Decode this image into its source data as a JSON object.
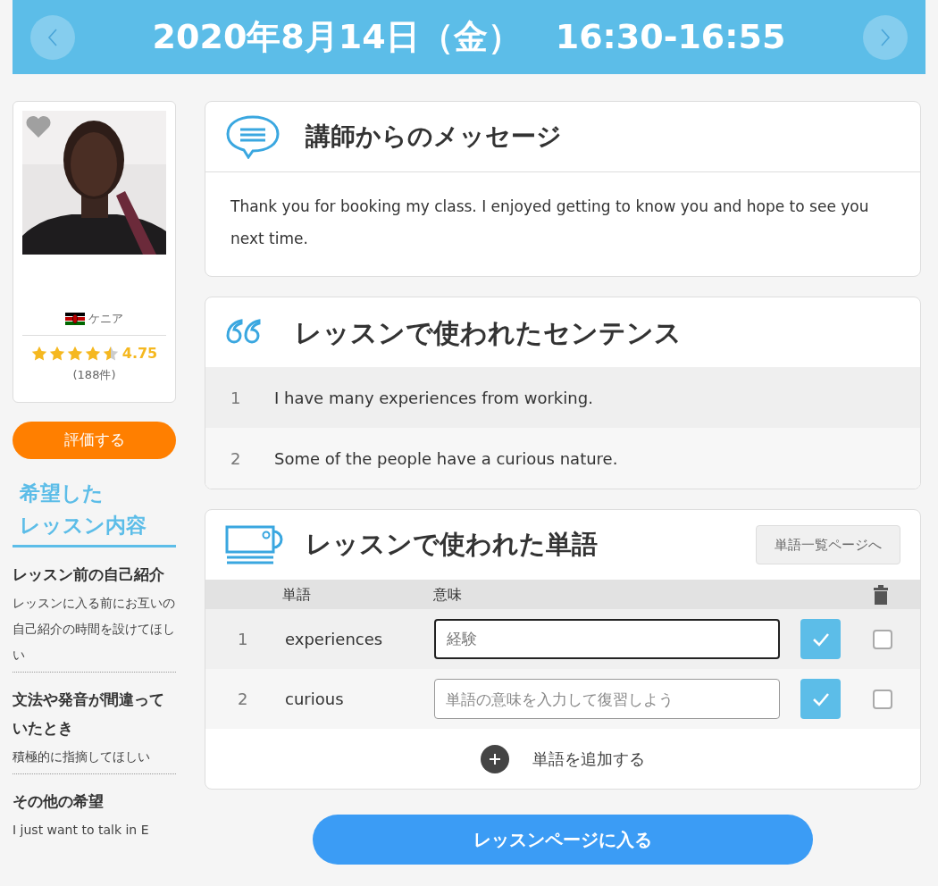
{
  "header": {
    "title": "2020年8月14日（金）　16:30-16:55"
  },
  "teacher": {
    "country": "ケニア",
    "stars": 4.5,
    "rating": "4.75",
    "reviews": "(188件)",
    "favorite": false
  },
  "rate_button": "評価する",
  "requests": {
    "heading": [
      "希望した",
      "レッスン内容"
    ],
    "items": [
      {
        "title": "レッスン前の自己紹介",
        "text": "レッスンに入る前にお互いの自己紹介の時間を設けてほしい"
      },
      {
        "title": "文法や発音が間違っていたとき",
        "text": "積極的に指摘してほしい"
      },
      {
        "title": "その他の希望",
        "text": "I just want to talk in E"
      }
    ]
  },
  "message": {
    "title": "講師からのメッセージ",
    "text": "Thank you for booking my class. I enjoyed getting to know you and hope to see you next time."
  },
  "sentences": {
    "title": "レッスンで使われたセンテンス",
    "items": [
      {
        "number": "1",
        "text": "I have many experiences from working."
      },
      {
        "number": "2",
        "text": "Some of the people have a curious nature."
      }
    ]
  },
  "words": {
    "title": "レッスンで使われた単語",
    "list_button": "単語一覧ページへ",
    "columns": [
      "単語",
      "意味"
    ],
    "rows": [
      {
        "number": "1",
        "word": "experiences",
        "meaning": "経験",
        "focused": true,
        "checked": false
      },
      {
        "number": "2",
        "word": "curious",
        "placeholder": "単語の意味を入力して復習しよう",
        "focused": false,
        "checked": false
      }
    ],
    "add_label": "単語を追加する"
  },
  "enter_button": "レッスンページに入る"
}
